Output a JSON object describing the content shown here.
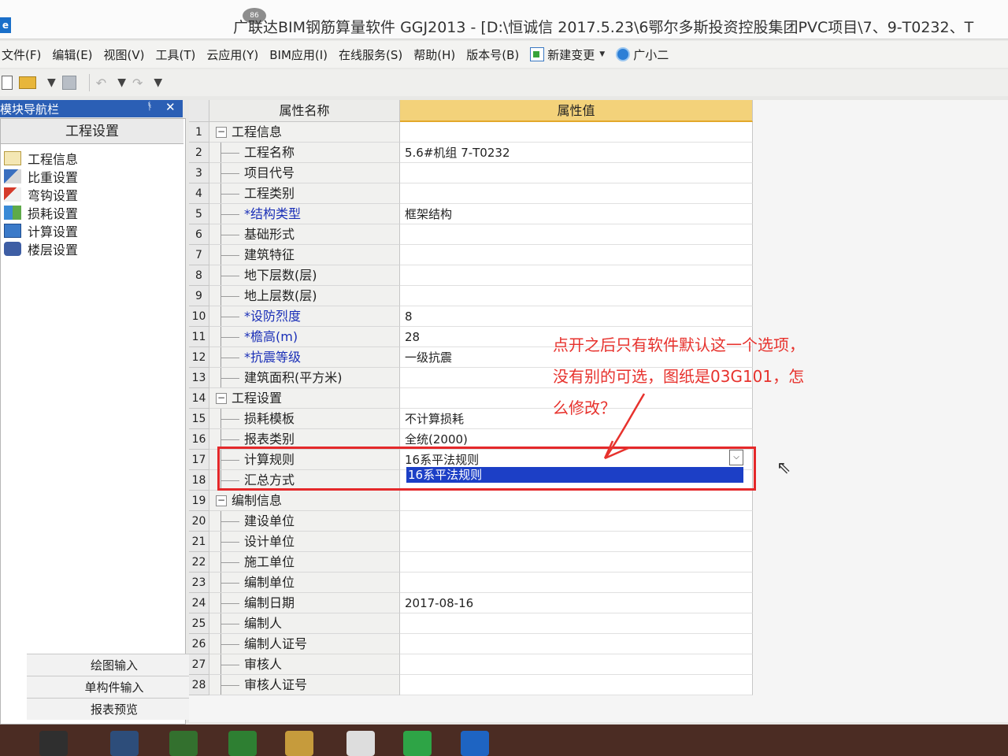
{
  "window": {
    "badge": "86",
    "title": "广联达BIM钢筋算量软件 GGJ2013 - [D:\\恒诚信 2017.5.23\\6鄂尔多斯投资控股集团PVC项目\\7、9-T0232、T"
  },
  "menu": [
    "文件(F)",
    "编辑(E)",
    "视图(V)",
    "工具(T)",
    "云应用(Y)",
    "BIM应用(I)",
    "在线服务(S)",
    "帮助(H)",
    "版本号(B)"
  ],
  "menu_extra": {
    "new_change": "新建变更",
    "assistant": "广小二"
  },
  "toolbar": {
    "undo": "↶",
    "redo": "↷"
  },
  "nav": {
    "title": "模块导航栏",
    "pin": "ᚬ",
    "close": "✕",
    "tab": "工程设置",
    "items": [
      "工程信息",
      "比重设置",
      "弯钩设置",
      "损耗设置",
      "计算设置",
      "楼层设置"
    ],
    "bottom": [
      "绘图输入",
      "单构件输入",
      "报表预览"
    ]
  },
  "grid": {
    "header_name": "属性名称",
    "header_value": "属性值",
    "rows": [
      {
        "num": "1",
        "name": "工程信息",
        "value": "",
        "group": true,
        "req": false
      },
      {
        "num": "2",
        "name": "工程名称",
        "value": "5.6#机组 7-T0232",
        "group": false,
        "req": false
      },
      {
        "num": "3",
        "name": "项目代号",
        "value": "",
        "group": false,
        "req": false
      },
      {
        "num": "4",
        "name": "工程类别",
        "value": "",
        "group": false,
        "req": false
      },
      {
        "num": "5",
        "name": "*结构类型",
        "value": "框架结构",
        "group": false,
        "req": true
      },
      {
        "num": "6",
        "name": "基础形式",
        "value": "",
        "group": false,
        "req": false
      },
      {
        "num": "7",
        "name": "建筑特征",
        "value": "",
        "group": false,
        "req": false
      },
      {
        "num": "8",
        "name": "地下层数(层)",
        "value": "",
        "group": false,
        "req": false
      },
      {
        "num": "9",
        "name": "地上层数(层)",
        "value": "",
        "group": false,
        "req": false
      },
      {
        "num": "10",
        "name": "*设防烈度",
        "value": "8",
        "group": false,
        "req": true
      },
      {
        "num": "11",
        "name": "*檐高(m)",
        "value": "28",
        "group": false,
        "req": true
      },
      {
        "num": "12",
        "name": "*抗震等级",
        "value": "一级抗震",
        "group": false,
        "req": true
      },
      {
        "num": "13",
        "name": "建筑面积(平方米)",
        "value": "",
        "group": false,
        "req": false
      },
      {
        "num": "14",
        "name": "工程设置",
        "value": "",
        "group": true,
        "req": false
      },
      {
        "num": "15",
        "name": "损耗模板",
        "value": "不计算损耗",
        "group": false,
        "req": false
      },
      {
        "num": "16",
        "name": "报表类别",
        "value": "全统(2000)",
        "group": false,
        "req": false
      },
      {
        "num": "17",
        "name": "计算规则",
        "value": "16系平法规则",
        "group": false,
        "req": false
      },
      {
        "num": "18",
        "name": "汇总方式",
        "value": "",
        "group": false,
        "req": false
      },
      {
        "num": "19",
        "name": "编制信息",
        "value": "",
        "group": true,
        "req": false
      },
      {
        "num": "20",
        "name": "建设单位",
        "value": "",
        "group": false,
        "req": false
      },
      {
        "num": "21",
        "name": "设计单位",
        "value": "",
        "group": false,
        "req": false
      },
      {
        "num": "22",
        "name": "施工单位",
        "value": "",
        "group": false,
        "req": false
      },
      {
        "num": "23",
        "name": "编制单位",
        "value": "",
        "group": false,
        "req": false
      },
      {
        "num": "24",
        "name": "编制日期",
        "value": "2017-08-16",
        "group": false,
        "req": false
      },
      {
        "num": "25",
        "name": "编制人",
        "value": "",
        "group": false,
        "req": false
      },
      {
        "num": "26",
        "name": "编制人证号",
        "value": "",
        "group": false,
        "req": false
      },
      {
        "num": "27",
        "name": "审核人",
        "value": "",
        "group": false,
        "req": false
      },
      {
        "num": "28",
        "name": "审核人证号",
        "value": "",
        "group": false,
        "req": false
      }
    ],
    "expander_symbol": "−",
    "dropdown_option": "16系平法规则",
    "dropdown_arrow": "⌵"
  },
  "annotation": {
    "line1": "点开之后只有软件默认这一个选项，",
    "line2": "没有别的可选，图纸是03G101，怎",
    "line3": "么修改？"
  },
  "colors": {
    "accent": "#2b5fb5",
    "header_value_bg": "#f3d27a",
    "highlight_red": "#e4282a",
    "annotation_red": "#e7322d",
    "required_blue": "#1a2fb7",
    "dropdown_selection": "#1c3fc6"
  }
}
